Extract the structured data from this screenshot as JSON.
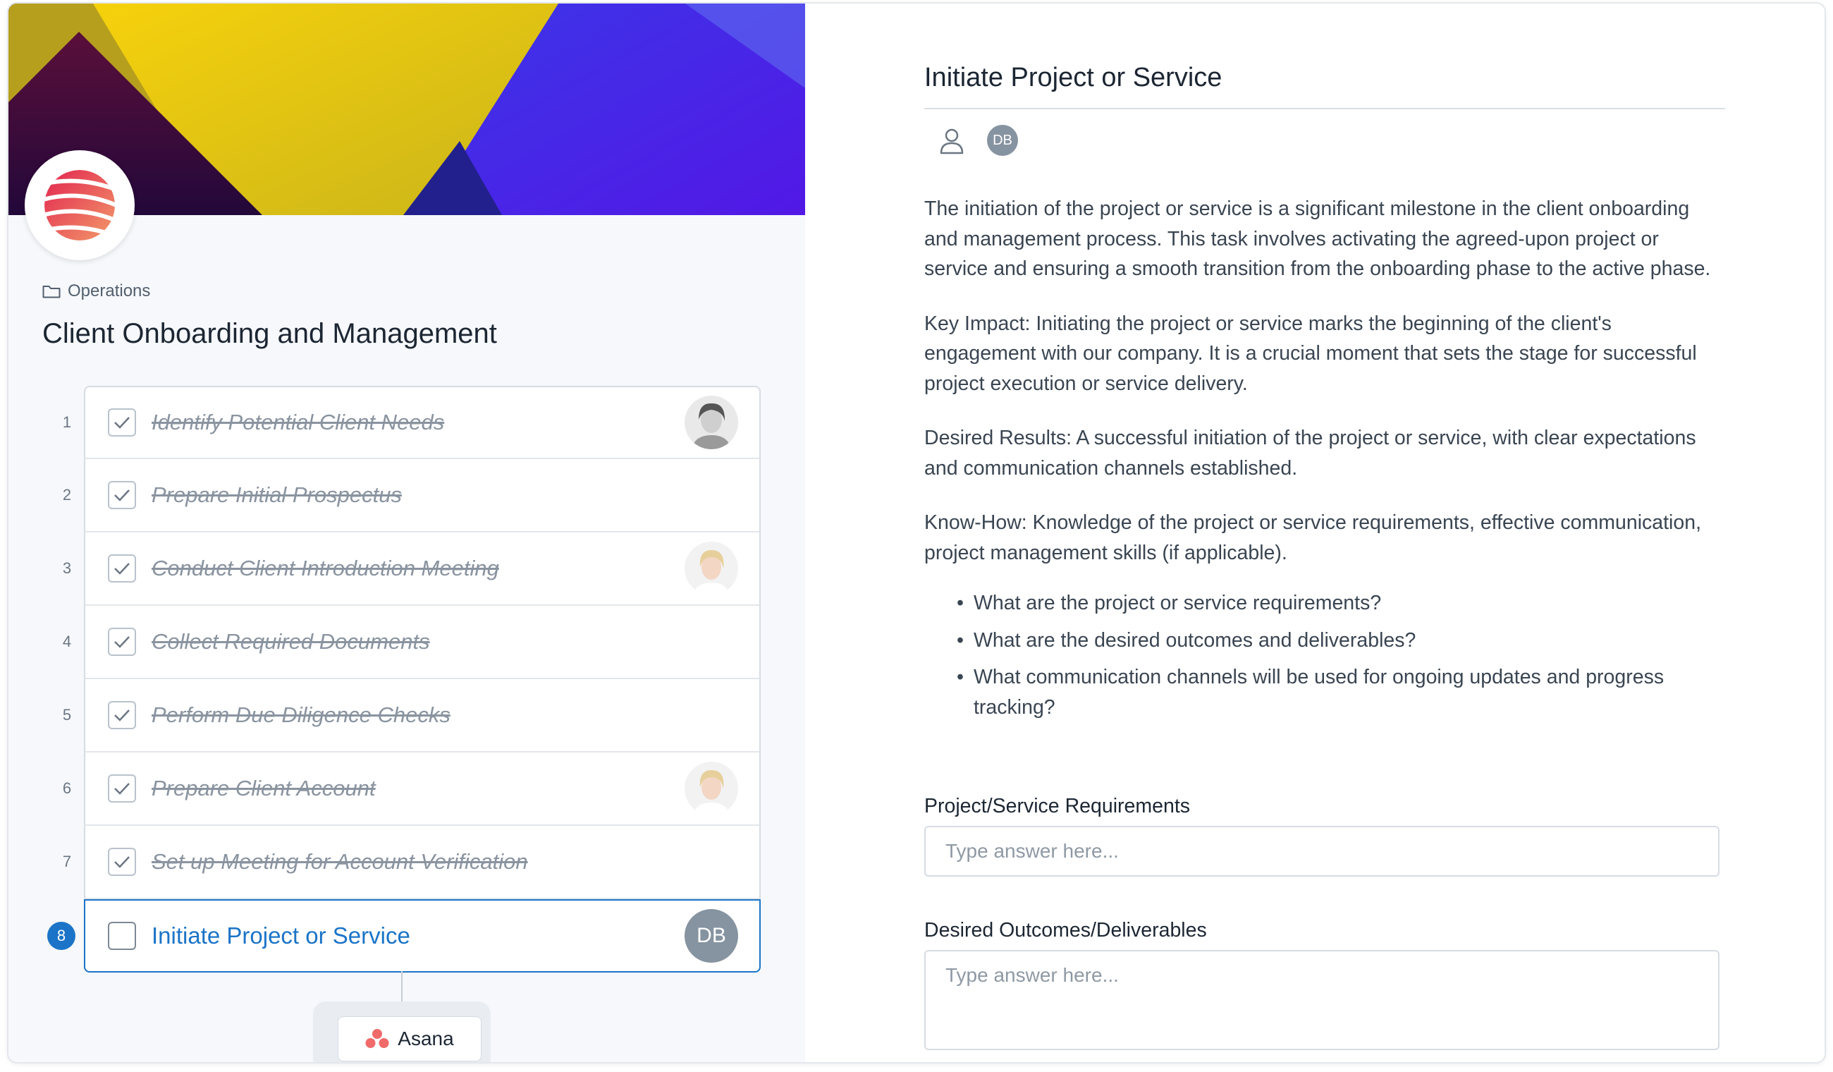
{
  "project": {
    "breadcrumb": "Operations",
    "title": "Client Onboarding and Management"
  },
  "tasks": [
    {
      "num": "1",
      "label": "Identify Potential Client Needs",
      "done": true,
      "avatar": "photo-1"
    },
    {
      "num": "2",
      "label": "Prepare Initial Prospectus",
      "done": true,
      "avatar": ""
    },
    {
      "num": "3",
      "label": "Conduct Client Introduction Meeting",
      "done": true,
      "avatar": "photo-2"
    },
    {
      "num": "4",
      "label": "Collect Required Documents",
      "done": true,
      "avatar": ""
    },
    {
      "num": "5",
      "label": "Perform Due Diligence Checks",
      "done": true,
      "avatar": ""
    },
    {
      "num": "6",
      "label": "Prepare Client Account",
      "done": true,
      "avatar": "photo-2"
    },
    {
      "num": "7",
      "label": "Set up Meeting for Account Verification",
      "done": true,
      "avatar": ""
    },
    {
      "num": "8",
      "label": "Initiate Project or Service",
      "done": false,
      "avatar_initials": "DB"
    }
  ],
  "integration": {
    "label": "Asana"
  },
  "detail": {
    "title": "Initiate Project or Service",
    "assignee_initials": "DB",
    "paragraphs": [
      "The initiation of the project or service is a significant milestone in the client onboarding and management process. This task involves activating the agreed-upon project or service and ensuring a smooth transition from the onboarding phase to the active phase.",
      "Key Impact: Initiating the project or service marks the beginning of the client's engagement with our company. It is a crucial moment that sets the stage for successful project execution or service delivery.",
      "Desired Results: A successful initiation of the project or service, with clear expectations and communication channels established.",
      "Know-How: Knowledge of the project or service requirements, effective communication, project management skills (if applicable)."
    ],
    "bullets": [
      "What are the project or service requirements?",
      "What are the desired outcomes and deliverables?",
      "What communication channels will be used for ongoing updates and progress tracking?"
    ],
    "fields": [
      {
        "label": "Project/Service Requirements",
        "placeholder": "Type answer here..."
      },
      {
        "label": "Desired Outcomes/Deliverables",
        "placeholder": "Type answer here..."
      }
    ]
  },
  "colors": {
    "accent": "#1b74c7",
    "banner_yellow": "#f2c811",
    "banner_purple": "#5b2be0",
    "logo_red": "#e8425a"
  }
}
